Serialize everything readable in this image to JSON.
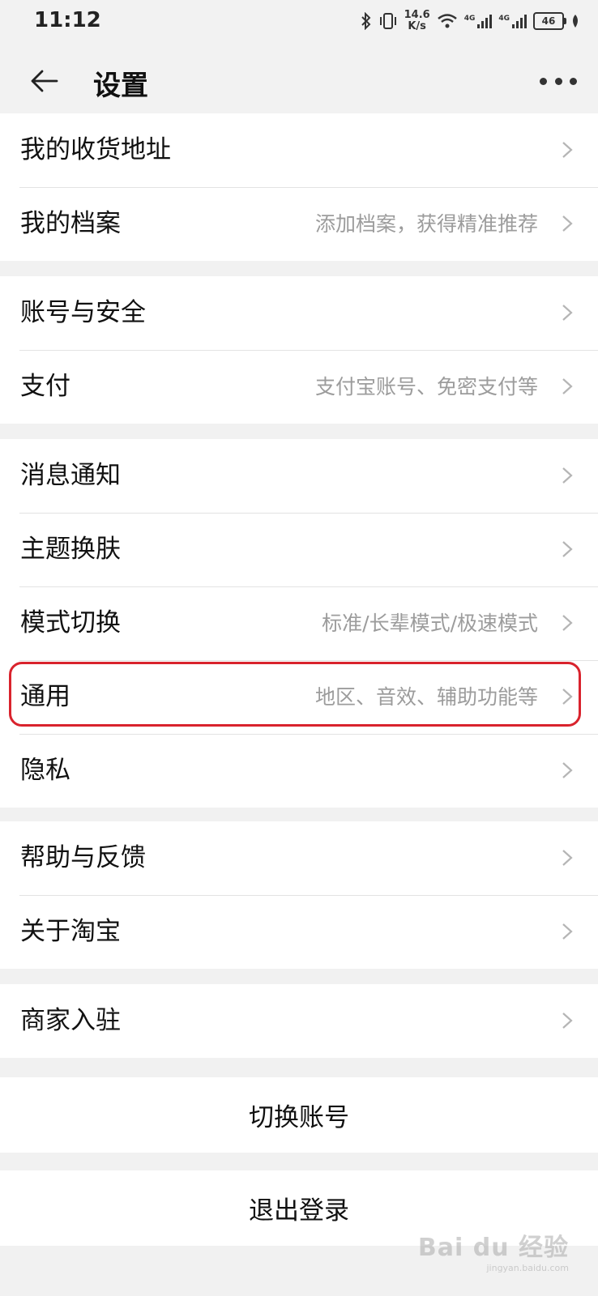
{
  "status_bar": {
    "time": "11:12",
    "speed_value": "14.6",
    "speed_unit": "K/s",
    "network_1": "4G",
    "network_2": "4G",
    "battery": "46"
  },
  "header": {
    "title": "设置"
  },
  "groups": [
    {
      "items": [
        {
          "label": "我的收货地址",
          "hint": ""
        },
        {
          "label": "我的档案",
          "hint": "添加档案，获得精准推荐"
        }
      ]
    },
    {
      "items": [
        {
          "label": "账号与安全",
          "hint": ""
        },
        {
          "label": "支付",
          "hint": "支付宝账号、免密支付等"
        }
      ]
    },
    {
      "items": [
        {
          "label": "消息通知",
          "hint": ""
        },
        {
          "label": "主题换肤",
          "hint": ""
        },
        {
          "label": "模式切换",
          "hint": "标准/长辈模式/极速模式"
        },
        {
          "label": "通用",
          "hint": "地区、音效、辅助功能等"
        },
        {
          "label": "隐私",
          "hint": ""
        }
      ]
    },
    {
      "items": [
        {
          "label": "帮助与反馈",
          "hint": ""
        },
        {
          "label": "关于淘宝",
          "hint": ""
        }
      ]
    },
    {
      "items": [
        {
          "label": "商家入驻",
          "hint": ""
        }
      ]
    }
  ],
  "actions": {
    "switch_account": "切换账号",
    "logout": "退出登录"
  },
  "watermark": {
    "text": "Bai du 经验",
    "sub": "jingyan.baidu.com"
  },
  "colors": {
    "highlight": "#d9232d",
    "background": "#f1f1f1"
  }
}
